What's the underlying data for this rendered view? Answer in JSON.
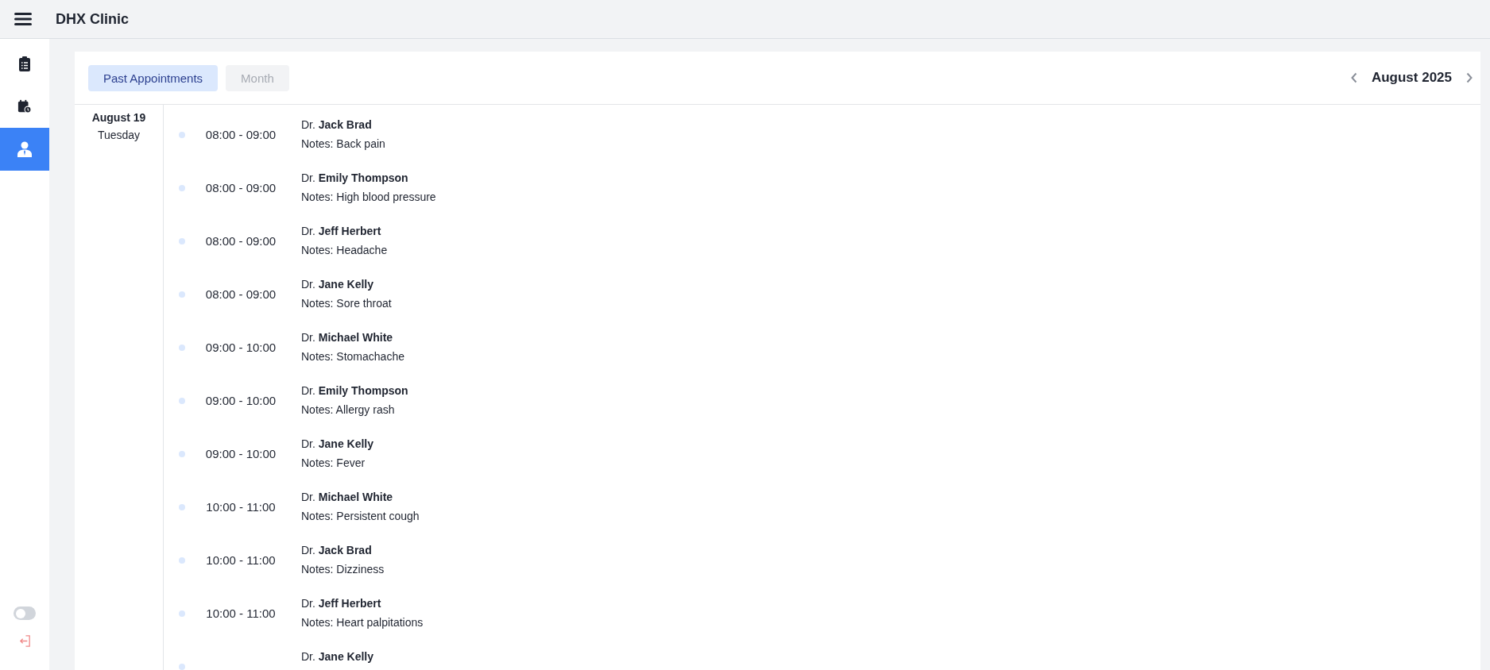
{
  "header": {
    "title": "DHX Clinic"
  },
  "sidebar": {
    "items": [
      {
        "kind": "clipboard",
        "selected": false
      },
      {
        "kind": "calendar",
        "selected": false
      },
      {
        "kind": "doctor",
        "selected": true
      }
    ],
    "theme_toggle": {
      "on": false
    }
  },
  "toolbar": {
    "tabs": [
      {
        "label": "Past Appointments",
        "selected": true
      },
      {
        "label": "Month",
        "selected": false
      }
    ],
    "period": "August 2025"
  },
  "day": {
    "date": "August 19",
    "weekday": "Tuesday"
  },
  "appointments": [
    {
      "time": "08:00 - 09:00",
      "doctor": "Dr. **Jack Brad**",
      "notes": "Notes: Back pain"
    },
    {
      "time": "08:00 - 09:00",
      "doctor": "Dr. **Emily Thompson**",
      "notes": "Notes: High blood pressure"
    },
    {
      "time": "08:00 - 09:00",
      "doctor": "Dr. **Jeff Herbert**",
      "notes": "Notes: Headache"
    },
    {
      "time": "08:00 - 09:00",
      "doctor": "Dr. **Jane Kelly**",
      "notes": "Notes: Sore throat"
    },
    {
      "time": "09:00 - 10:00",
      "doctor": "Dr. **Michael White**",
      "notes": "Notes: Stomachache"
    },
    {
      "time": "09:00 - 10:00",
      "doctor": "Dr. **Emily Thompson**",
      "notes": "Notes: Allergy rash"
    },
    {
      "time": "09:00 - 10:00",
      "doctor": "Dr. **Jane Kelly**",
      "notes": "Notes: Fever"
    },
    {
      "time": "10:00 - 11:00",
      "doctor": "Dr. **Michael White**",
      "notes": "Notes: Persistent cough"
    },
    {
      "time": "10:00 - 11:00",
      "doctor": "Dr. **Jack Brad**",
      "notes": "Notes: Dizziness"
    },
    {
      "time": "10:00 - 11:00",
      "doctor": "Dr. **Jeff Herbert**",
      "notes": "Notes: Heart palpitations"
    },
    {
      "doctor": "Dr. **Jane Kelly**"
    }
  ]
}
